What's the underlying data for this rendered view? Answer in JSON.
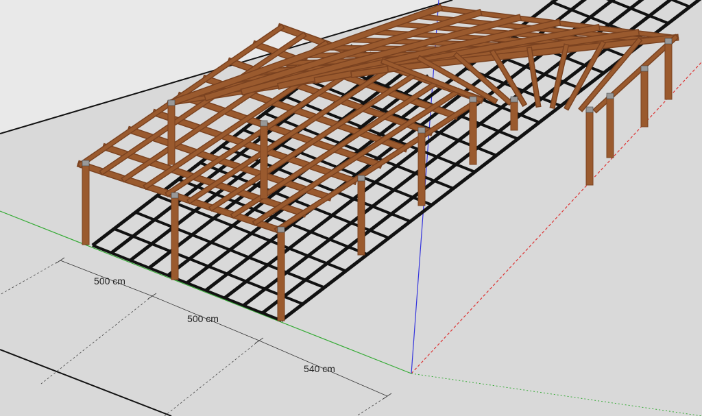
{
  "viewport": {
    "background": "#e9e9e9",
    "ground_color": "#d9d9d9",
    "timber_color": "#9a5a2e",
    "timber_side_color": "#7a4220",
    "shadow_color": "#111111",
    "axis_green": "#33aa33",
    "axis_red": "#dd3333",
    "axis_blue": "#3333dd"
  },
  "dimensions": [
    {
      "label": "500 cm"
    },
    {
      "label": "500 cm"
    },
    {
      "label": "540 cm"
    }
  ]
}
